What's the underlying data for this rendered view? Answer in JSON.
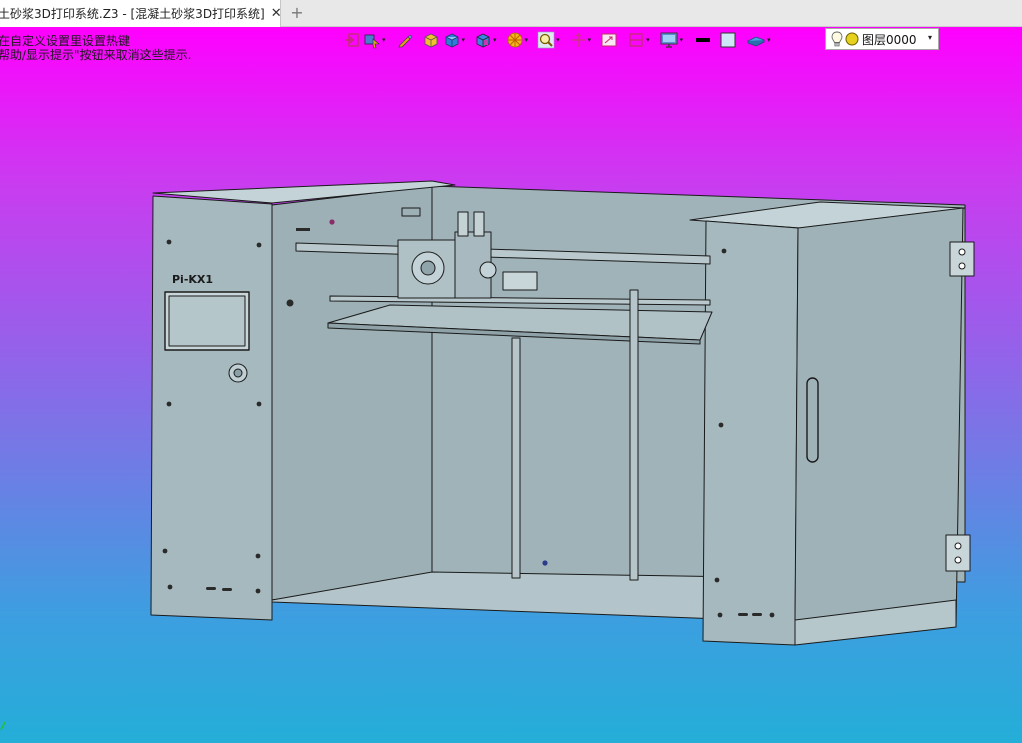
{
  "tab": {
    "title": "土砂浆3D打印系统.Z3 - [混凝土砂浆3D打印系统]",
    "close_glyph": "✕",
    "new_glyph": "+"
  },
  "hints": {
    "line1": "在自定义设置里设置热键",
    "line2": "帮助/显示提示\"按钮来取消这些提示."
  },
  "toolbar": {
    "items": [
      {
        "name": "exit-icon"
      },
      {
        "name": "select-filter-icon"
      },
      {
        "name": "pencil-icon"
      },
      {
        "name": "shaded-cube-icon"
      },
      {
        "name": "blue-cube-icon"
      },
      {
        "name": "cube-faces-icon"
      },
      {
        "name": "sun-render-icon"
      },
      {
        "name": "zoom-icon"
      },
      {
        "name": "rotate-axis-icon"
      },
      {
        "name": "window-icon"
      },
      {
        "name": "view-frame-icon"
      },
      {
        "name": "monitor-icon"
      },
      {
        "name": "line-style-icon"
      },
      {
        "name": "color-swatch-icon"
      },
      {
        "name": "plane-icon"
      }
    ],
    "dropdown_glyph": "▾"
  },
  "layer": {
    "label": "图层0000",
    "arrow_glyph": "▾"
  },
  "model": {
    "panel_label": "Pi-KX1"
  },
  "colors": {
    "model_fill": "#a4b7bd",
    "model_edge": "#1a1a1a",
    "gradient_top": "#ff00ff",
    "gradient_bottom": "#24aed8"
  }
}
